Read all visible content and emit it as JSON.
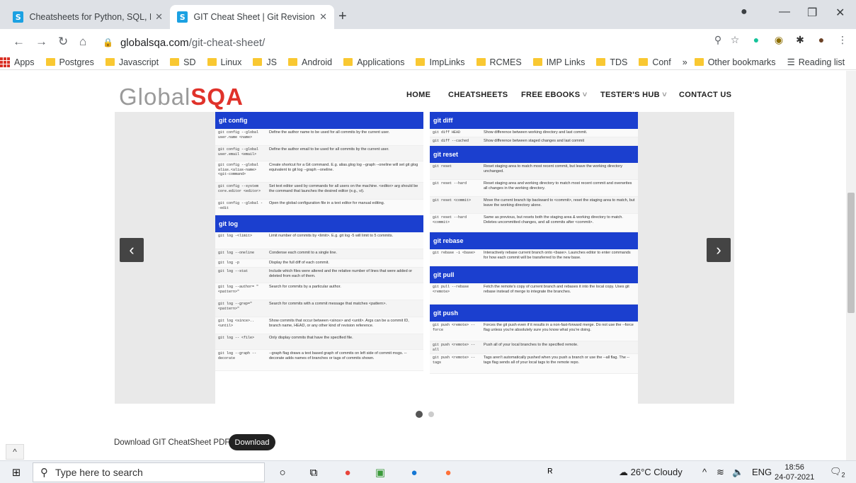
{
  "browser": {
    "tabs": [
      {
        "favicon": "S",
        "title": "Cheatsheets for Python, SQL, ML"
      },
      {
        "favicon": "S",
        "title": "GIT Cheat Sheet | Git Revision in"
      }
    ],
    "new_tab": "+",
    "url_host": "globalsqa.com",
    "url_path": "/git-cheat-sheet/",
    "bookmarks": [
      "Apps",
      "Postgres",
      "Javascript",
      "SD",
      "Linux",
      "JS",
      "Android",
      "Applications",
      "ImpLinks",
      "RCMES",
      "IMP Links",
      "TDS",
      "Conf"
    ],
    "more_bookmarks": "»",
    "other_bookmarks": "Other bookmarks",
    "reading_list": "Reading list"
  },
  "site": {
    "logo_a": "Global",
    "logo_b": "SQA",
    "menu": [
      "HOME",
      "CHEATSHEETS",
      "FREE EBOOKS",
      "TESTER'S HUB",
      "CONTACT US"
    ],
    "menu_dropdown_mark": "˅"
  },
  "sheet": {
    "left": [
      {
        "title": "git config",
        "rows": [
          {
            "cmd": "git config --global user.name <name>",
            "desc": "Define the author name to be used for all commits by the current user."
          },
          {
            "cmd": "git config --global user.email <email>",
            "desc": "Define the author email to be used for all commits by the current user."
          },
          {
            "cmd": "git config --global alias.<alias-name> <git-command>",
            "desc": "Create shortcut for a Git command. E.g. alias.glog log --graph --oneline will set git glog equivalent to git log --graph --oneline."
          },
          {
            "cmd": "git config --system core.editor <editor>",
            "desc": "Set text editor used by commands for all users on the machine. <editor> arg should be the command that launches the desired editor (e.g., vi)."
          },
          {
            "cmd": "git config --global --edit",
            "desc": "Open the global configuration file in a text editor for manual editing."
          }
        ]
      },
      {
        "title": "git log",
        "rows": [
          {
            "cmd": "git log -<limit>",
            "desc": "Limit number of commits by <limit>. E.g. git log -5 will limit to 5 commits."
          },
          {
            "cmd": "git log --oneline",
            "desc": "Condense each commit to a single line."
          },
          {
            "cmd": "git log -p",
            "desc": "Display the full diff of each commit."
          },
          {
            "cmd": "git log --stat",
            "desc": "Include which files were altered and the relative number of lines that were added or deleted from each of them."
          },
          {
            "cmd": "git log --author= \"<pattern>\"",
            "desc": "Search for commits by a particular author."
          },
          {
            "cmd": "git log --grep=\"<pattern>\"",
            "desc": "Search for commits with a commit message that matches <pattern>."
          },
          {
            "cmd": "git log <since>..<until>",
            "desc": "Show commits that occur between <since> and <until>. Args can be a commit ID, branch name, HEAD, or any other kind of revision reference."
          },
          {
            "cmd": "git log -- <file>",
            "desc": "Only display commits that have the specified file."
          },
          {
            "cmd": "git log --graph --decorate",
            "desc": "--graph flag draws a text based graph of commits on left side of commit msgs. --decorate adds names of branches or tags of commits shown."
          }
        ]
      }
    ],
    "right": [
      {
        "title": "git diff",
        "rows": [
          {
            "cmd": "git diff HEAD",
            "desc": "Show difference between working directory and last commit."
          },
          {
            "cmd": "git diff --cached",
            "desc": "Show difference between staged changes and last commit"
          }
        ]
      },
      {
        "title": "git reset",
        "rows": [
          {
            "cmd": "git reset",
            "desc": "Reset staging area to match most recent commit, but leave the working directory unchanged."
          },
          {
            "cmd": "git reset --hard",
            "desc": "Reset staging area and working directory to match most recent commit and overwrites all changes in the working directory."
          },
          {
            "cmd": "git reset <commit>",
            "desc": "Move the current branch tip backward to <commit>, reset the staging area to match, but leave the working directory alone."
          },
          {
            "cmd": "git reset --hard <commit>",
            "desc": "Same as previous, but resets both the staging area & working directory to match. Deletes uncommitted changes, and all commits after <commit>."
          }
        ]
      },
      {
        "title": "git rebase",
        "rows": [
          {
            "cmd": "git rebase -i <base>",
            "desc": "Interactively rebase current branch onto <base>. Launches editor to enter commands for how each commit will be transferred to the new base."
          }
        ]
      },
      {
        "title": "git pull",
        "rows": [
          {
            "cmd": "git pull --rebase <remote>",
            "desc": "Fetch the remote's copy of current branch and rebases it into the local copy. Uses git rebase instead of merge to integrate the branches."
          }
        ]
      },
      {
        "title": "git push",
        "rows": [
          {
            "cmd": "git push <remote> --force",
            "desc": "Forces the git push even if it results in a non-fast-forward merge. Do not use the --force flag unless you're absolutely sure you know what you're doing."
          },
          {
            "cmd": "git push <remote> --all",
            "desc": "Push all of your local branches to the specified remote."
          },
          {
            "cmd": "git push <remote> --tags",
            "desc": "Tags aren't automatically pushed when you push a branch or use the --all flag. The --tags flag sends all of your local tags to the remote repo."
          }
        ]
      }
    ]
  },
  "carousel": {
    "prev": "‹",
    "next": "›"
  },
  "download": {
    "label": "Download GIT CheatSheet PDF",
    "button": "Download"
  },
  "taskbar": {
    "search_placeholder": "Type here to search",
    "weather": "26°C Cloudy",
    "lang": "ENG",
    "time": "18:56",
    "date": "24-07-2021",
    "notification_count": "2"
  },
  "colors": {
    "accent": "#1b3fcf",
    "logo_red": "#e0322a"
  }
}
